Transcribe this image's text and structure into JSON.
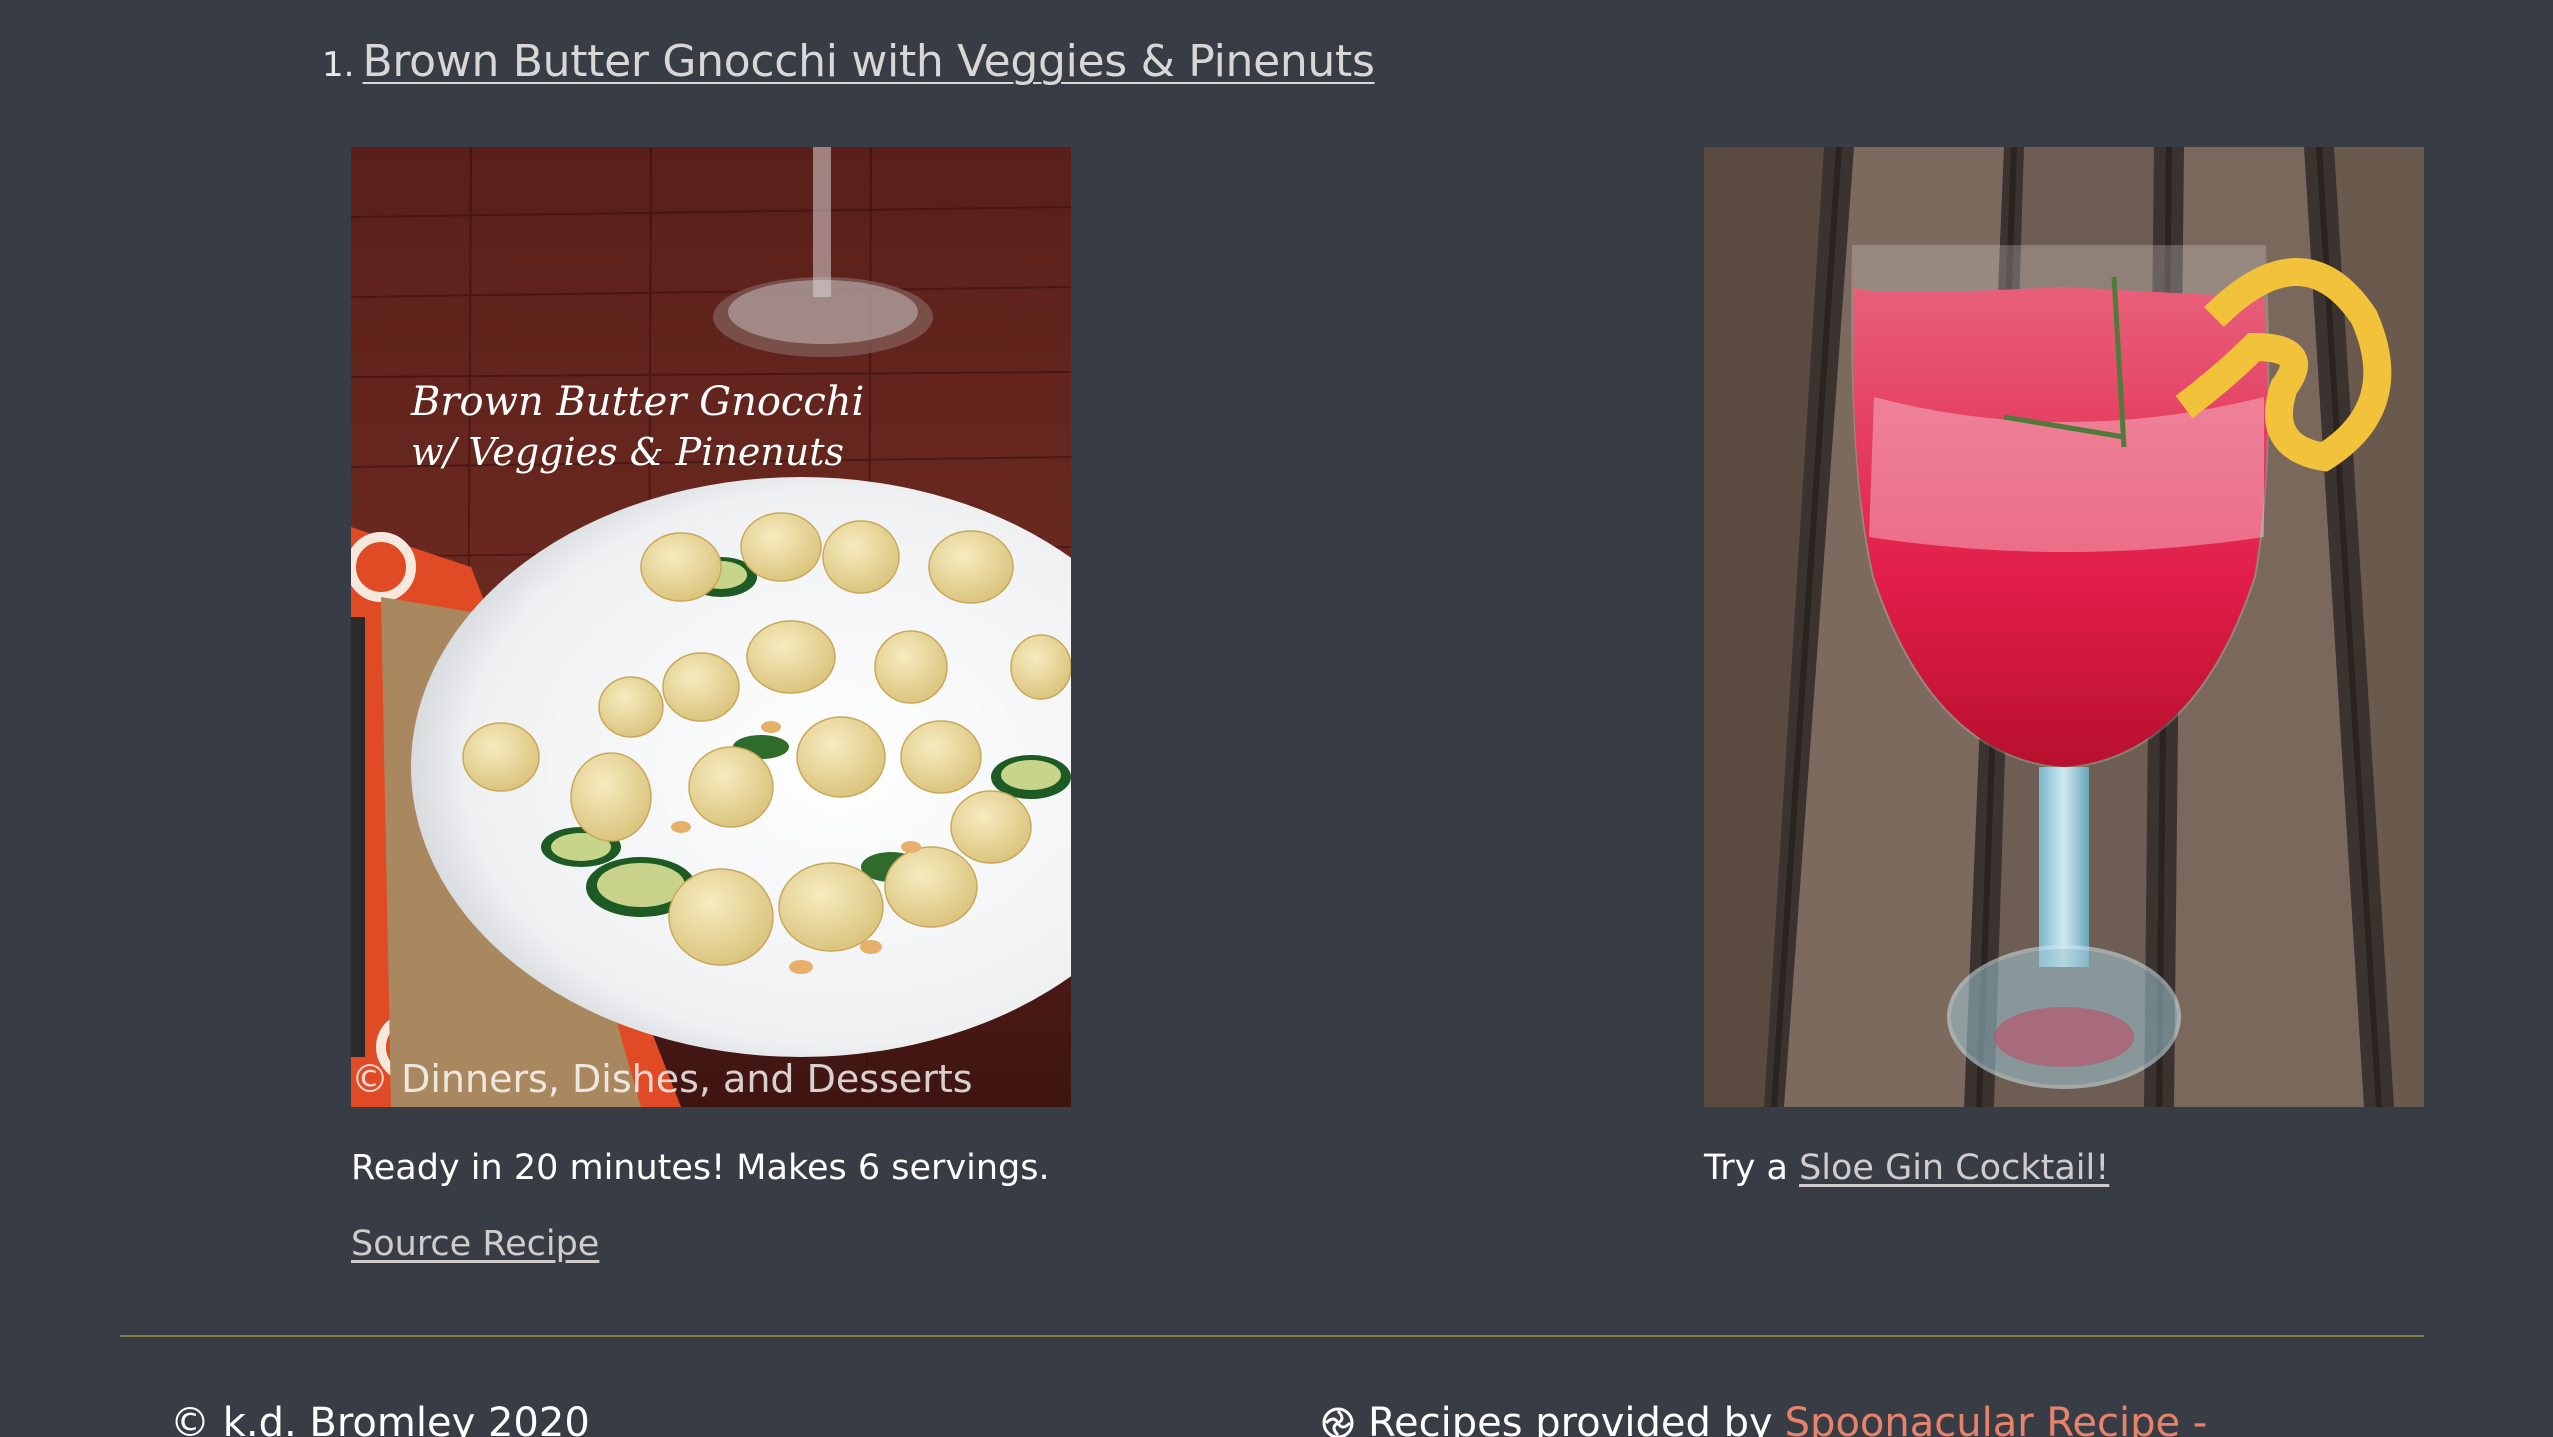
{
  "recipe": {
    "number": "1.",
    "title": "Brown Butter Gnocchi with Veggies & Pinenuts",
    "photo_caption_line1": "Brown Butter Gnocchi",
    "photo_caption_line2": "w/ Veggies & Pinenuts",
    "photo_watermark": "© Dinners, Dishes, and Desserts",
    "ready_text": "Ready in 20 minutes! Makes 6 servings.",
    "source_label": "Source Recipe"
  },
  "pairing": {
    "prefix": "Try a",
    "link_label": "Sloe Gin Cocktail!"
  },
  "footer": {
    "copyright": "© k.d. Bromley 2020",
    "credit_prefix": "Recipes provided by",
    "credit_link": "Spoonacular Recipe -"
  },
  "colors": {
    "background": "#383d45",
    "link": "#d0cccc",
    "accent_link": "#e8826a",
    "divider": "#8a7a45"
  }
}
